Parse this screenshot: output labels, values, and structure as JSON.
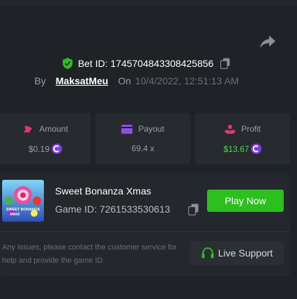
{
  "bet": {
    "id_text": "Bet ID: 1745704843308425856",
    "by_label": "By",
    "username": "MaksatMeu",
    "on_label": "On",
    "datetime": "10/4/2022, 12:51:13 AM"
  },
  "stats": {
    "amount": {
      "label": "Amount",
      "value": "$0.19",
      "icon": "amount-icon"
    },
    "payout": {
      "label": "Payout",
      "value": "69.4 x",
      "icon": "wallet-icon"
    },
    "profit": {
      "label": "Profit",
      "value": "$13.67",
      "icon": "profit-icon"
    }
  },
  "game": {
    "name": "Sweet Bonanza Xmas",
    "id_text": "Game ID: 7261533530613",
    "thumb_text_1": "SWEET BONANZA",
    "thumb_text_2": "XMAS",
    "play_label": "Play Now"
  },
  "help": {
    "text": "Any issues, please contact the customer service for help and provide the game ID.",
    "support_label": "Live Support"
  },
  "colors": {
    "accent_green": "#2cbf1e",
    "profit_green": "#48e04c",
    "amount_pink": "#e0366d",
    "payout_purple": "#8b4fe6",
    "coin_purple": "#7b3fe4"
  }
}
